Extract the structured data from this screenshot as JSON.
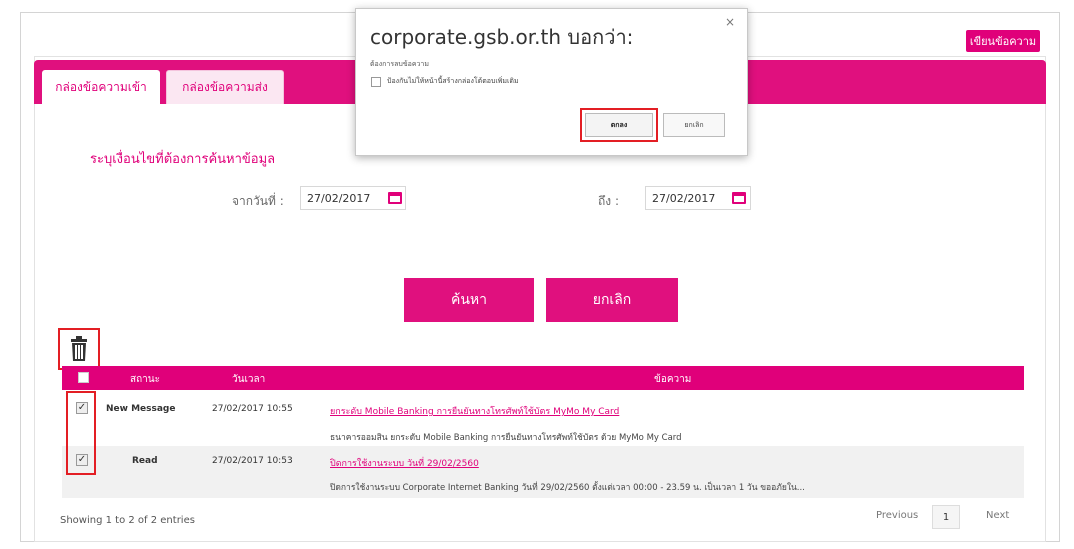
{
  "compose_label": "เขียนข้อความ",
  "tabs": [
    {
      "label": "กล่องข้อความเข้า"
    },
    {
      "label": "กล่องข้อความส่ง"
    }
  ],
  "search": {
    "title": "ระบุเงื่อนไขที่ต้องการค้นหาข้อมูล",
    "from_label": "จากวันที่ :",
    "from_value": "27/02/2017",
    "to_label": "ถึง :",
    "to_value": "27/02/2017",
    "search_button": "ค้นหา",
    "cancel_button": "ยกเลิก"
  },
  "table": {
    "headers": [
      "สถานะ",
      "วันเวลา",
      "ข้อความ"
    ],
    "rows": [
      {
        "status": "New Message",
        "datetime": "27/02/2017 10:55",
        "subject": "ยกระดับ Mobile Banking การยืนยันทางโทรศัพท์ใช้บัตร MyMo My Card",
        "preview": "ธนาคารออมสิน ยกระดับ Mobile Banking การยืนยันทางโทรศัพท์ใช้บัตร ด้วย  MyMo My Card",
        "checked": true
      },
      {
        "status": "Read",
        "datetime": "27/02/2017 10:53",
        "subject": "ปิดการใช้งานระบบ วันที่ 29/02/2560",
        "preview": "ปิดการใช้งานระบบ Corporate Internet Banking วันที่ 29/02/2560 ตั้งแต่เวลา 00:00 - 23.59 น. เป็นเวลา 1 วัน ขออภัยใน...",
        "checked": true
      }
    ]
  },
  "footer": {
    "showing": "Showing 1 to 2 of 2 entries",
    "previous": "Previous",
    "page": "1",
    "next": "Next"
  },
  "dialog": {
    "title": "corporate.gsb.or.th บอกว่า:",
    "message": "ต้องการลบข้อความ",
    "checkbox_label": "ป้องกันไม่ให้หน้านี้สร้างกล่องโต้ตอบเพิ่มเติม",
    "ok": "ตกลง",
    "cancel": "ยกเลิก",
    "close": "×"
  },
  "colors": {
    "accent": "#e0007a",
    "highlight": "#e31e24"
  }
}
